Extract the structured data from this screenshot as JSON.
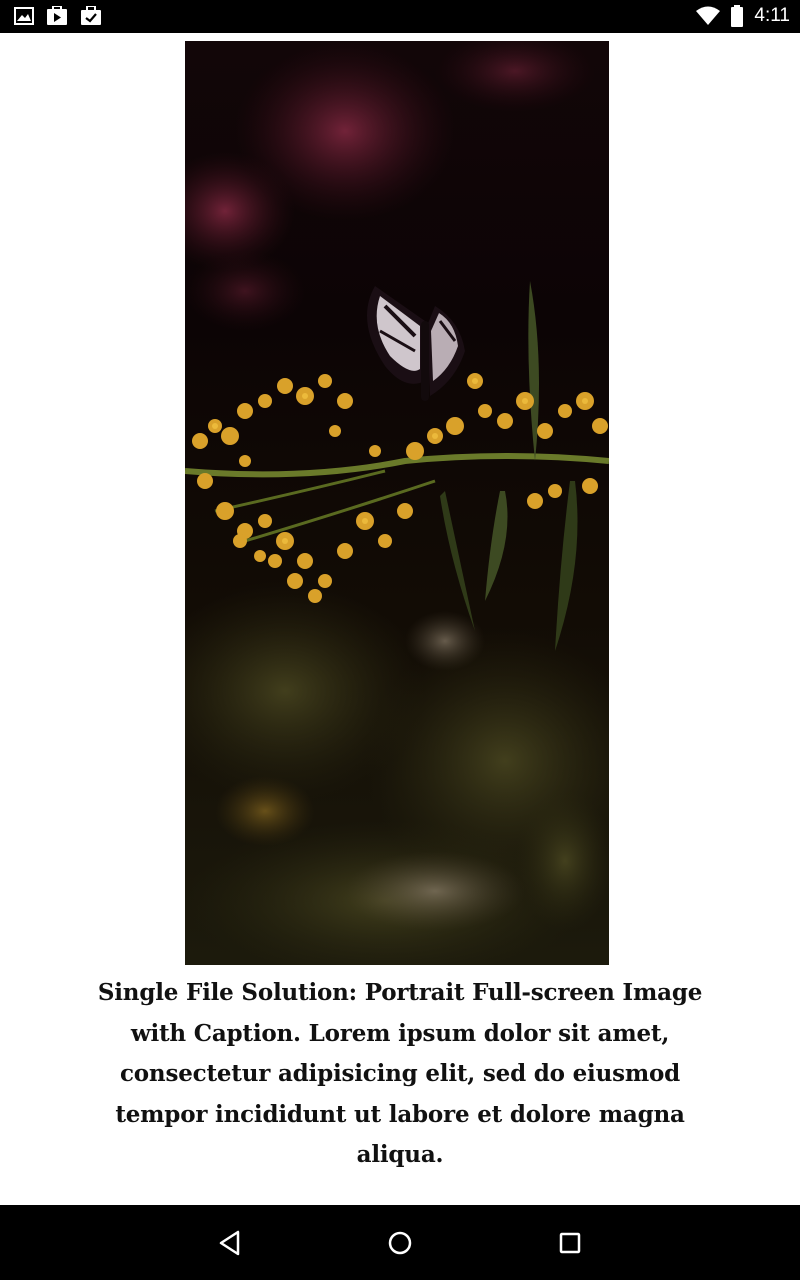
{
  "status_bar": {
    "time": "4:11",
    "notification_icons": [
      "gallery-icon",
      "play-store-icon",
      "shopping-bag-icon"
    ],
    "system_icons": [
      "wifi-icon",
      "battery-icon"
    ]
  },
  "content": {
    "image_alt": "butterfly-on-yellow-flowers",
    "caption": "Single File Solution: Portrait Full-screen Image with Caption. Lorem ipsum dolor sit amet, consectetur adipisicing elit, sed do eiusmod tempor incididunt ut labore et dolore magna aliqua."
  },
  "nav_bar": {
    "buttons": [
      "back-icon",
      "home-icon",
      "recents-icon"
    ]
  },
  "colors": {
    "bars": "#000000",
    "page_background": "#ffffff",
    "caption_text": "#111111"
  }
}
